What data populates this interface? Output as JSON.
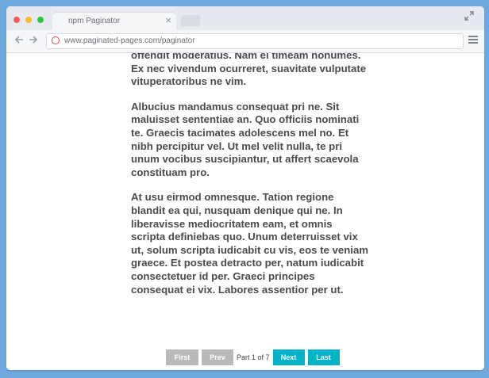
{
  "browser": {
    "tab_title": "npm Paginator",
    "tab_close": "×",
    "url": "www.paginated-pages.com/paginator",
    "icons": {
      "back": "arrow-left-icon",
      "forward": "arrow-right-icon",
      "site": "dribbble-icon",
      "menu": "hamburger-menu-icon",
      "expand": "expand-icon"
    },
    "window_controls": [
      "#f25a4f",
      "#f6bd2e",
      "#29c840"
    ]
  },
  "article": {
    "paragraphs": [
      "offendit moderatius. Nam ei timeam nonumes. Ex nec vivendum ocurreret, suavitate vulputate vituperatoribus ne vim.",
      "Albucius mandamus consequat pri ne. Sit maluisset sententiae an. Quo officiis nominati te. Graecis tacimates adolescens mel no. Et nibh percipitur vel. Ut mel velit nulla, te pri unum vocibus suscipiantur, ut affert scaevola constituam pro.",
      "At usu eirmod omnesque. Tation regione blandit ea qui, nusquam denique qui ne. In liberavisse mediocritatem eam, et omnis scripta definiebas quo. Unum deterruisset vix ut, solum scripta iudicabit cu vis, eos te veniam graece. Et postea detracto per, natum iudicabit consectetuer id per. Graeci principes consequat ei vix. Labores assentior per ut."
    ]
  },
  "pagination": {
    "first": "First",
    "prev": "Prev",
    "page_info": "Part 1 of 7",
    "next": "Next",
    "last": "Last",
    "current_page": 1,
    "total_pages": 7,
    "colors": {
      "disabled": "#b9babc",
      "active": "#00b3c9"
    }
  }
}
